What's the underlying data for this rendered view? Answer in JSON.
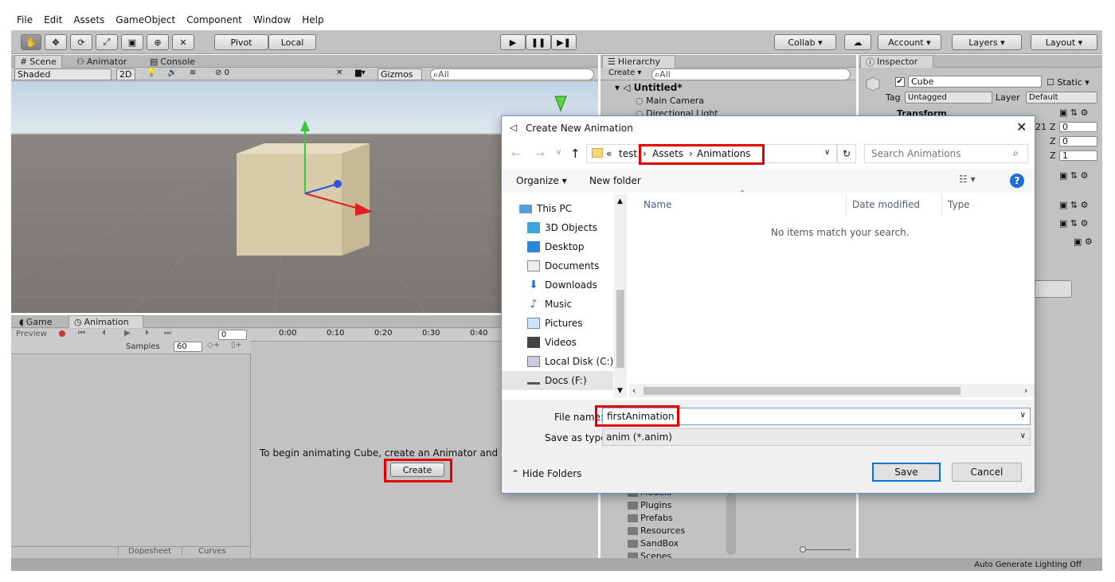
{
  "menubar": {
    "items": [
      "File",
      "Edit",
      "Assets",
      "GameObject",
      "Component",
      "Window",
      "Help"
    ]
  },
  "toolbar": {
    "pivot": "Pivot",
    "local": "Local",
    "collab": "Collab ▾",
    "account": "Account",
    "layers": "Layers",
    "layout": "Layout"
  },
  "scene": {
    "tabs": [
      "Scene",
      "Animator",
      "Console"
    ],
    "shading": "Shaded",
    "mode2d": "2D",
    "fx_count": "0",
    "gizmos": "Gizmos",
    "search_placeholder": "All"
  },
  "animation": {
    "tabs": [
      "Game",
      "Animation"
    ],
    "preview": "Preview",
    "frame": "0",
    "samples_label": "Samples",
    "samples_value": "60",
    "ruler": [
      "0:00",
      "0:10",
      "0:20",
      "0:30",
      "0:40"
    ],
    "message": "To begin animating Cube, create an Animator and an",
    "create": "Create",
    "dopesheet": "Dopesheet",
    "curves": "Curves"
  },
  "hierarchy": {
    "tab": "Hierarchy",
    "create": "Create ▾",
    "search_placeholder": "All",
    "scene_name": "Untitled*",
    "items": [
      "Main Camera",
      "Directional Light"
    ],
    "folders": [
      "Models",
      "Plugins",
      "Prefabs",
      "Resources",
      "SandBox",
      "Scenes"
    ]
  },
  "inspector": {
    "tab": "Inspector",
    "object_name": "Cube",
    "static": "Static",
    "tag_label": "Tag",
    "tag_value": "Untagged",
    "layer_label": "Layer",
    "layer_value": "Default",
    "transform": "Transform",
    "z_values": [
      "0",
      "0",
      "1"
    ],
    "z_label": "Z",
    "partial_value": "21"
  },
  "status": {
    "text": "Auto Generate Lighting Off"
  },
  "dialog": {
    "title": "Create New Animation",
    "path": [
      "test",
      "Assets",
      "Animations"
    ],
    "path_prefix": "«",
    "search_placeholder": "Search Animations",
    "organize": "Organize ▾",
    "new_folder": "New folder",
    "nav": [
      "This PC",
      "3D Objects",
      "Desktop",
      "Documents",
      "Downloads",
      "Music",
      "Pictures",
      "Videos",
      "Local Disk (C:)",
      "Docs (F:)"
    ],
    "col_name": "Name",
    "col_date": "Date modified",
    "col_type": "Type",
    "empty": "No items match your search.",
    "file_name_label": "File name:",
    "file_name_value": "firstAnimation",
    "save_type_label": "Save as type:",
    "save_type_value": "anim (*.anim)",
    "hide_folders": "Hide Folders",
    "save": "Save",
    "cancel": "Cancel"
  },
  "colors": {
    "highlight": "#e00000",
    "unity_panel": "#c2c2c2",
    "accent": "#0078d7"
  }
}
